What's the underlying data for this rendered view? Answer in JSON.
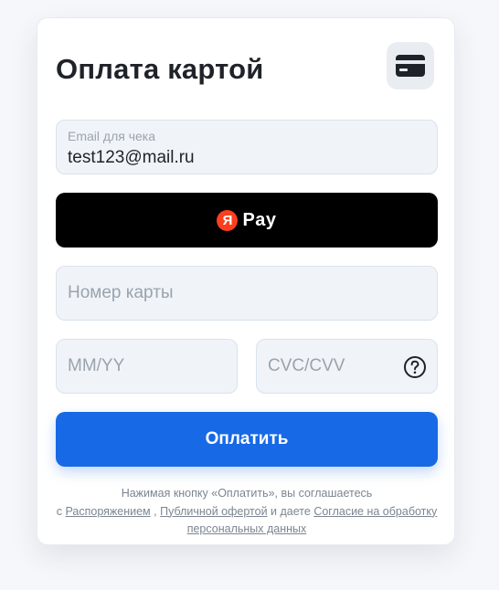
{
  "header": {
    "title": "Оплата картой",
    "icon": "credit-card-icon"
  },
  "email": {
    "label": "Email для чека",
    "value": "test123@mail.ru"
  },
  "yandex_pay": {
    "logo_letter": "Я",
    "label": "Pay",
    "logo_color": "#fc3f1d"
  },
  "card_number": {
    "placeholder": "Номер карты"
  },
  "expiry": {
    "placeholder": "MM/YY"
  },
  "cvc": {
    "placeholder": "CVC/CVV",
    "help_icon": "question-circle-icon"
  },
  "pay_button": {
    "label": "Оплатить",
    "color": "#1769e6"
  },
  "consent": {
    "line1": "Нажимая кнопку «Оплатить», вы соглашаетесь",
    "prefix": "с",
    "link1": "Распоряжением",
    "sep": ",",
    "link2": "Публичной офертой",
    "mid": "и даете",
    "link3": "Согласие на обработку персональных данных"
  }
}
